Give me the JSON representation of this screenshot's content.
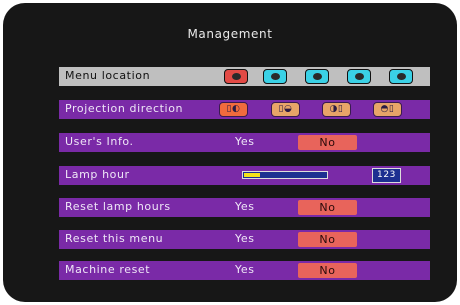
{
  "title": "Management",
  "menu_location": {
    "label": "Menu location",
    "selected_index": 0,
    "icons": [
      "position-center-icon",
      "position-top-left-icon",
      "position-top-right-icon",
      "position-bottom-left-icon",
      "position-bottom-right-icon"
    ]
  },
  "projection_direction": {
    "label": "Projection direction",
    "selected_index": 0,
    "icons": [
      "front-desktop-icon",
      "front-ceiling-icon",
      "rear-desktop-icon",
      "rear-ceiling-icon"
    ]
  },
  "users_info": {
    "label": "User's Info.",
    "yes": "Yes",
    "no": "No"
  },
  "lamp_hour": {
    "label": "Lamp hour",
    "value": "123",
    "fraction": 0.2
  },
  "reset_lamp_hours": {
    "label": "Reset lamp hours",
    "yes": "Yes",
    "no": "No"
  },
  "reset_this_menu": {
    "label": "Reset this menu",
    "yes": "Yes",
    "no": "No"
  },
  "machine_reset": {
    "label": "Machine reset",
    "yes": "Yes",
    "no": "No"
  },
  "colors": {
    "row": "#7a2aa7",
    "selected_row": "#bfbfbf",
    "no_button": "#e8645b",
    "lamp_bar": "#f5e21b",
    "lamp_track": "#1d2f91"
  }
}
